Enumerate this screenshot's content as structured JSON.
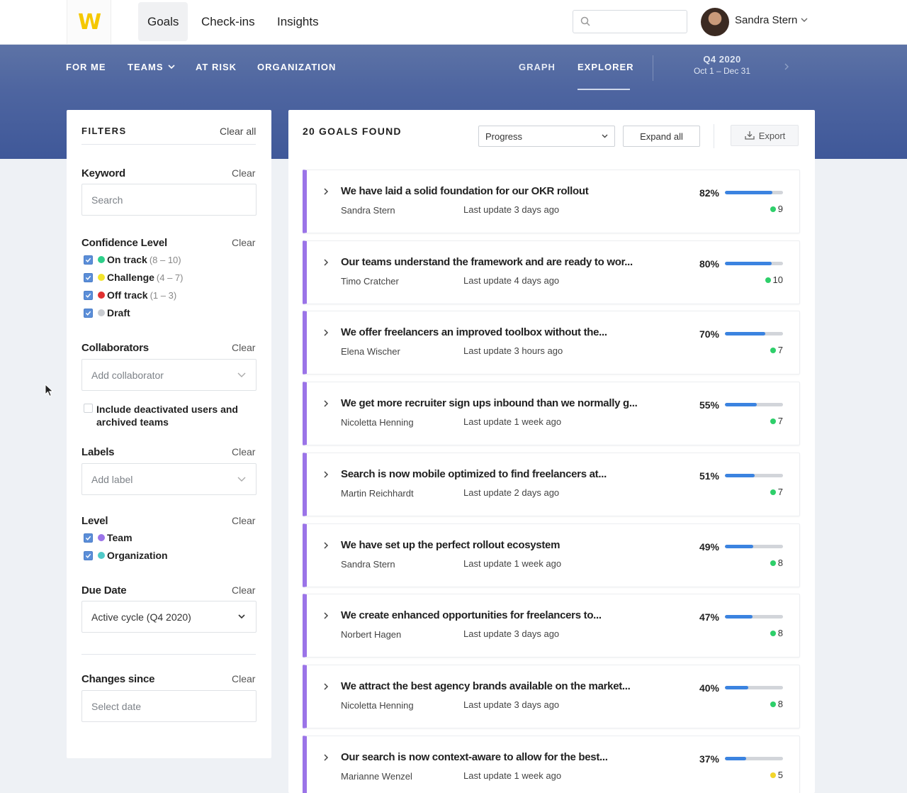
{
  "colors": {
    "brand_yellow": "#f5c800",
    "band_blue": "#4e65a0",
    "goal_accent": "#9b74e8",
    "progress_blue": "#3b83e0",
    "on_track": "#2ecf8a",
    "challenge": "#f2e32b",
    "off_track": "#e03030",
    "draft": "#c8cbd0",
    "team": "#9b74e8",
    "organization": "#4fc9c8",
    "confidence_green": "#2ecf6a",
    "confidence_yellow": "#f2d52b"
  },
  "topbar": {
    "logo_text": "W",
    "tabs": [
      {
        "label": "Goals",
        "active": true
      },
      {
        "label": "Check-ins",
        "active": false
      },
      {
        "label": "Insights",
        "active": false
      }
    ],
    "search_placeholder": "",
    "user_name": "Sandra Stern"
  },
  "subnav": {
    "left": [
      "FOR ME",
      "TEAMS",
      "AT RISK",
      "ORGANIZATION"
    ],
    "right": [
      "GRAPH",
      "EXPLORER"
    ],
    "active": "EXPLORER",
    "cycle_title": "Q4 2020",
    "cycle_range": "Oct 1 – Dec 31"
  },
  "filters": {
    "heading": "FILTERS",
    "clear_all": "Clear all",
    "clear": "Clear",
    "keyword": {
      "label": "Keyword",
      "placeholder": "Search"
    },
    "confidence": {
      "label": "Confidence Level",
      "items": [
        {
          "text": "On track",
          "range": "(8 – 10)",
          "checked": true
        },
        {
          "text": "Challenge",
          "range": "(4 – 7)",
          "checked": true
        },
        {
          "text": "Off track",
          "range": "(1 – 3)",
          "checked": true
        },
        {
          "text": "Draft",
          "range": "",
          "checked": true
        }
      ]
    },
    "collaborators": {
      "label": "Collaborators",
      "placeholder": "Add collaborator",
      "deactivated_text": "Include deactivated users and archived teams",
      "deactivated_checked": false
    },
    "labels": {
      "label": "Labels",
      "placeholder": "Add label"
    },
    "level": {
      "label": "Level",
      "items": [
        {
          "text": "Team",
          "checked": true
        },
        {
          "text": "Organization",
          "checked": true
        }
      ]
    },
    "due_date": {
      "label": "Due Date",
      "value": "Active cycle (Q4 2020)"
    },
    "changes_since": {
      "label": "Changes since",
      "placeholder": "Select date"
    }
  },
  "results": {
    "heading": "20 GOALS FOUND",
    "sort_value": "Progress",
    "expand_all": "Expand all",
    "export": "Export",
    "goals": [
      {
        "title": "We have laid a solid foundation for our OKR rollout",
        "owner": "Sandra Stern",
        "updated": "Last update 3 days ago",
        "progress_label": "82%",
        "progress": 82,
        "confidence": "9",
        "confidence_color": "green"
      },
      {
        "title": "Our teams understand the framework and are ready to wor...",
        "owner": "Timo Cratcher",
        "updated": "Last update 4 days ago",
        "progress_label": "80%",
        "progress": 80,
        "confidence": "10",
        "confidence_color": "green"
      },
      {
        "title": "We offer freelancers an improved toolbox without the...",
        "owner": "Elena Wischer",
        "updated": "Last update 3 hours ago",
        "progress_label": "70%",
        "progress": 70,
        "confidence": "7",
        "confidence_color": "green"
      },
      {
        "title": "We get more recruiter sign ups inbound than we normally g...",
        "owner": "Nicoletta Henning",
        "updated": "Last update 1 week ago",
        "progress_label": "55%",
        "progress": 55,
        "confidence": "7",
        "confidence_color": "green"
      },
      {
        "title": "Search is now mobile optimized to find freelancers at...",
        "owner": "Martin Reichhardt",
        "updated": "Last update 2 days ago",
        "progress_label": "51%",
        "progress": 51,
        "confidence": "7",
        "confidence_color": "green"
      },
      {
        "title": "We have set up the perfect rollout ecosystem",
        "owner": "Sandra Stern",
        "updated": "Last update 1 week ago",
        "progress_label": "49%",
        "progress": 49,
        "confidence": "8",
        "confidence_color": "green"
      },
      {
        "title": "We create enhanced opportunities for freelancers to...",
        "owner": "Norbert Hagen",
        "updated": "Last update 3 days ago",
        "progress_label": "47%",
        "progress": 47,
        "confidence": "8",
        "confidence_color": "green"
      },
      {
        "title": "We attract the best agency brands available on the market...",
        "owner": "Nicoletta Henning",
        "updated": "Last update 3 days ago",
        "progress_label": "40%",
        "progress": 40,
        "confidence": "8",
        "confidence_color": "green"
      },
      {
        "title": "Our search is now context-aware to allow for the best...",
        "owner": "Marianne Wenzel",
        "updated": "Last update 1 week ago",
        "progress_label": "37%",
        "progress": 37,
        "confidence": "5",
        "confidence_color": "yellow"
      }
    ]
  }
}
